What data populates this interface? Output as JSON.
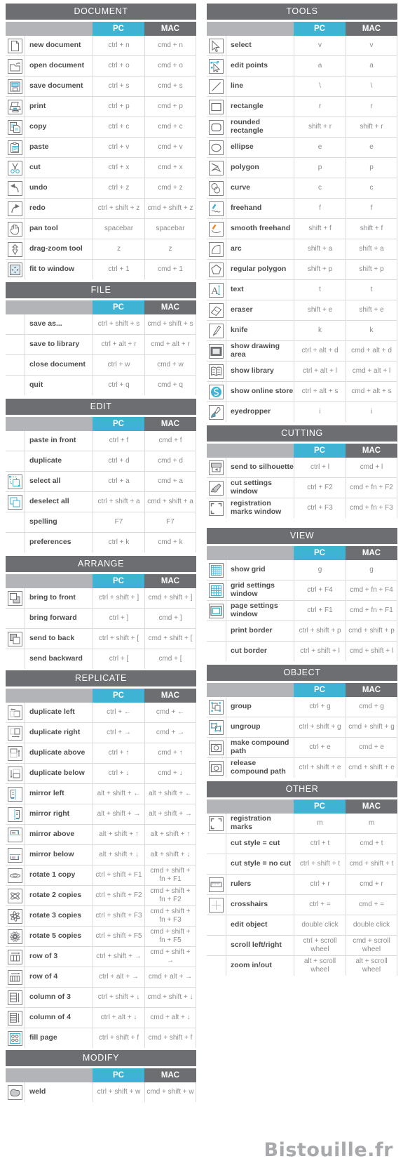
{
  "theme": {
    "section_header_bg": "#6d6e71",
    "pc_header_bg": "#3eb3d4",
    "mac_header_bg": "#6d6e71",
    "blank_header_bg": "#b3b4b8",
    "row_divider": "#d9dadb",
    "label_color": "#4d4d4f",
    "key_color": "#8a8b8e",
    "watermark_color": "#a7a9ac"
  },
  "columns": {
    "pc": "PC",
    "mac": "MAC"
  },
  "watermark": "Bistouille.fr",
  "left": [
    {
      "title": "DOCUMENT",
      "rows": [
        {
          "icon": "new-document-icon",
          "label": "new document",
          "pc": "ctrl + n",
          "mac": "cmd + n"
        },
        {
          "icon": "open-document-icon",
          "label": "open document",
          "pc": "ctrl + o",
          "mac": "cmd + o"
        },
        {
          "icon": "save-document-icon",
          "label": "save document",
          "pc": "ctrl + s",
          "mac": "cmd + s"
        },
        {
          "icon": "print-icon",
          "label": "print",
          "pc": "ctrl + p",
          "mac": "cmd + p"
        },
        {
          "icon": "copy-icon",
          "label": "copy",
          "pc": "ctrl + c",
          "mac": "cmd + c"
        },
        {
          "icon": "paste-icon",
          "label": "paste",
          "pc": "ctrl + v",
          "mac": "cmd + v"
        },
        {
          "icon": "cut-icon",
          "label": "cut",
          "pc": "ctrl + x",
          "mac": "cmd + x"
        },
        {
          "icon": "undo-icon",
          "label": "undo",
          "pc": "ctrl + z",
          "mac": "cmd + z"
        },
        {
          "icon": "redo-icon",
          "label": "redo",
          "pc": "ctrl + shift + z",
          "mac": "cmd + shift + z"
        },
        {
          "icon": "pan-tool-icon",
          "label": "pan tool",
          "pc": "spacebar",
          "mac": "spacebar"
        },
        {
          "icon": "drag-zoom-tool-icon",
          "label": "drag-zoom tool",
          "pc": "z",
          "mac": "z"
        },
        {
          "icon": "fit-to-window-icon",
          "label": "fit to window",
          "pc": "ctrl + 1",
          "mac": "cmd + 1"
        }
      ]
    },
    {
      "title": "FILE",
      "rows": [
        {
          "icon": null,
          "label": "save as...",
          "pc": "ctrl + shift + s",
          "mac": "cmd + shift + s"
        },
        {
          "icon": null,
          "label": "save to library",
          "pc": "ctrl + alt + r",
          "mac": "cmd + alt + r"
        },
        {
          "icon": null,
          "label": "close document",
          "pc": "ctrl + w",
          "mac": "cmd + w"
        },
        {
          "icon": null,
          "label": "quit",
          "pc": "ctrl + q",
          "mac": "cmd + q"
        }
      ]
    },
    {
      "title": "EDIT",
      "rows": [
        {
          "icon": null,
          "label": "paste in front",
          "pc": "ctrl + f",
          "mac": "cmd + f"
        },
        {
          "icon": null,
          "label": "duplicate",
          "pc": "ctrl + d",
          "mac": "cmd + d"
        },
        {
          "icon": "select-all-icon",
          "label": "select all",
          "pc": "ctrl + a",
          "mac": "cmd + a"
        },
        {
          "icon": "deselect-all-icon",
          "label": "deselect all",
          "pc": "ctrl + shift + a",
          "mac": "cmd + shift + a"
        },
        {
          "icon": null,
          "label": "spelling",
          "pc": "F7",
          "mac": "F7"
        },
        {
          "icon": null,
          "label": "preferences",
          "pc": "ctrl + k",
          "mac": "cmd + k"
        }
      ]
    },
    {
      "title": "ARRANGE",
      "rows": [
        {
          "icon": "bring-to-front-icon",
          "label": "bring to front",
          "pc": "ctrl + shift + ]",
          "mac": "cmd + shift + ]"
        },
        {
          "icon": null,
          "label": "bring forward",
          "pc": "ctrl + ]",
          "mac": "cmd + ]"
        },
        {
          "icon": "send-to-back-icon",
          "label": "send to back",
          "pc": "ctrl + shift  + [",
          "mac": "cmd + shift + ["
        },
        {
          "icon": null,
          "label": "send backward",
          "pc": "ctrl + [",
          "mac": "cmd + ["
        }
      ]
    },
    {
      "title": "REPLICATE",
      "rows": [
        {
          "icon": "duplicate-left-icon",
          "label": "duplicate left",
          "pc": "ctrl + ←",
          "mac": "cmd + ←"
        },
        {
          "icon": "duplicate-right-icon",
          "label": "duplicate right",
          "pc": "ctrl + →",
          "mac": "cmd + →"
        },
        {
          "icon": "duplicate-above-icon",
          "label": "duplicate above",
          "pc": "ctrl + ↑",
          "mac": "cmd + ↑"
        },
        {
          "icon": "duplicate-below-icon",
          "label": "duplicate below",
          "pc": "ctrl + ↓",
          "mac": "cmd + ↓"
        },
        {
          "icon": "mirror-left-icon",
          "label": "mirror left",
          "pc": "alt + shift + ←",
          "mac": "alt + shift + ←"
        },
        {
          "icon": "mirror-right-icon",
          "label": "mirror right",
          "pc": "alt + shift + →",
          "mac": "alt + shift + →"
        },
        {
          "icon": "mirror-above-icon",
          "label": "mirror above",
          "pc": "alt + shift + ↑",
          "mac": "alt + shift + ↑"
        },
        {
          "icon": "mirror-below-icon",
          "label": "mirror below",
          "pc": "alt + shift + ↓",
          "mac": "alt + shift + ↓"
        },
        {
          "icon": "rotate-1-copy-icon",
          "label": "rotate 1 copy",
          "pc": "ctrl + shift + F1",
          "mac": "cmd + shift + fn + F1"
        },
        {
          "icon": "rotate-2-copies-icon",
          "label": "rotate 2 copies",
          "pc": "ctrl + shift + F2",
          "mac": "cmd + shift + fn + F2"
        },
        {
          "icon": "rotate-3-copies-icon",
          "label": "rotate 3 copies",
          "pc": "ctrl + shift + F3",
          "mac": "cmd + shift + fn + F3"
        },
        {
          "icon": "rotate-5-copies-icon",
          "label": "rotate 5 copies",
          "pc": "ctrl + shift + F5",
          "mac": "cmd + shift + fn + F5"
        },
        {
          "icon": "row-of-3-icon",
          "label": "row of 3",
          "pc": "ctrl + shift + →",
          "mac": "cmd + shift + →"
        },
        {
          "icon": "row-of-4-icon",
          "label": "row of 4",
          "pc": "ctrl + alt + →",
          "mac": "cmd + alt + →"
        },
        {
          "icon": "column-of-3-icon",
          "label": "column of 3",
          "pc": "ctrl + shift + ↓",
          "mac": "cmd + shift + ↓"
        },
        {
          "icon": "column-of-4-icon",
          "label": "column of 4",
          "pc": "ctrl + alt + ↓",
          "mac": "cmd + alt + ↓"
        },
        {
          "icon": "fill-page-icon",
          "label": "fill page",
          "pc": "ctrl + shift + f",
          "mac": "cmd + shift + f"
        }
      ]
    },
    {
      "title": "MODIFY",
      "rows": [
        {
          "icon": "weld-icon",
          "label": "weld",
          "pc": "ctrl + shift + w",
          "mac": "cmd + shift + w"
        }
      ]
    }
  ],
  "right": [
    {
      "title": "TOOLS",
      "rows": [
        {
          "icon": "select-icon",
          "label": "select",
          "pc": "v",
          "mac": "v"
        },
        {
          "icon": "edit-points-icon",
          "label": "edit points",
          "pc": "a",
          "mac": "a"
        },
        {
          "icon": "line-icon",
          "label": "line",
          "pc": "\\",
          "mac": "\\"
        },
        {
          "icon": "rectangle-icon",
          "label": "rectangle",
          "pc": "r",
          "mac": "r"
        },
        {
          "icon": "rounded-rectangle-icon",
          "label": "rounded rectangle",
          "pc": "shift + r",
          "mac": "shift + r"
        },
        {
          "icon": "ellipse-icon",
          "label": "ellipse",
          "pc": "e",
          "mac": "e"
        },
        {
          "icon": "polygon-icon",
          "label": "polygon",
          "pc": "p",
          "mac": "p"
        },
        {
          "icon": "curve-icon",
          "label": "curve",
          "pc": "c",
          "mac": "c"
        },
        {
          "icon": "freehand-icon",
          "label": "freehand",
          "pc": "f",
          "mac": "f"
        },
        {
          "icon": "smooth-freehand-icon",
          "label": "smooth freehand",
          "pc": "shift + f",
          "mac": "shift + f"
        },
        {
          "icon": "arc-icon",
          "label": "arc",
          "pc": "shift + a",
          "mac": "shift + a"
        },
        {
          "icon": "regular-polygon-icon",
          "label": "regular polygon",
          "pc": "shift + p",
          "mac": "shift + p"
        },
        {
          "icon": "text-icon",
          "label": "text",
          "pc": "t",
          "mac": "t"
        },
        {
          "icon": "eraser-icon",
          "label": "eraser",
          "pc": "shift + e",
          "mac": "shift + e"
        },
        {
          "icon": "knife-icon",
          "label": "knife",
          "pc": "k",
          "mac": "k"
        },
        {
          "icon": "show-drawing-area-icon",
          "label": "show drawing area",
          "pc": "ctrl + alt + d",
          "mac": "cmd + alt + d"
        },
        {
          "icon": "show-library-icon",
          "label": "show library",
          "pc": "ctrl + alt + l",
          "mac": "cmd + alt + l"
        },
        {
          "icon": "show-online-store-icon",
          "label": "show online store",
          "pc": "ctrl + alt + s",
          "mac": "cmd + alt + s"
        },
        {
          "icon": "eyedropper-icon",
          "label": "eyedropper",
          "pc": "i",
          "mac": "i"
        }
      ]
    },
    {
      "title": "CUTTING",
      "rows": [
        {
          "icon": "send-to-silhouette-icon",
          "label": "send to silhouette",
          "pc": "ctrl + l",
          "mac": "cmd + l"
        },
        {
          "icon": "cut-settings-window-icon",
          "label": "cut settings window",
          "pc": "ctrl + F2",
          "mac": "cmd + fn + F2"
        },
        {
          "icon": "registration-marks-window-icon",
          "label": "registration marks window",
          "pc": "ctrl + F3",
          "mac": "cmd + fn + F3"
        }
      ]
    },
    {
      "title": "VIEW",
      "rows": [
        {
          "icon": "show-grid-icon",
          "label": "show grid",
          "pc": "g",
          "mac": "g"
        },
        {
          "icon": "grid-settings-window-icon",
          "label": "grid settings window",
          "pc": "ctrl + F4",
          "mac": "cmd + fn + F4"
        },
        {
          "icon": "page-settings-window-icon",
          "label": "page settings window",
          "pc": "ctrl + F1",
          "mac": "cmd + fn + F1"
        },
        {
          "icon": null,
          "label": "print border",
          "pc": "ctrl + shift + p",
          "mac": "cmd + shift + p"
        },
        {
          "icon": null,
          "label": "cut border",
          "pc": "ctrl + shift + l",
          "mac": "cmd + shift + l"
        }
      ]
    },
    {
      "title": "OBJECT",
      "rows": [
        {
          "icon": "group-icon",
          "label": "group",
          "pc": "ctrl + g",
          "mac": "cmd + g"
        },
        {
          "icon": "ungroup-icon",
          "label": "ungroup",
          "pc": "ctrl + shift + g",
          "mac": "cmd + shift + g"
        },
        {
          "icon": "make-compound-path-icon",
          "label": "make compound path",
          "pc": "ctrl + e",
          "mac": "cmd + e"
        },
        {
          "icon": "release-compound-path-icon",
          "label": "release compound path",
          "pc": "ctrl + shift + e",
          "mac": "cmd + shift + e"
        }
      ]
    },
    {
      "title": "OTHER",
      "rows": [
        {
          "icon": "registration-marks-icon",
          "label": "registration marks",
          "pc": "m",
          "mac": "m"
        },
        {
          "icon": null,
          "label": "cut style = cut",
          "pc": "ctrl + t",
          "mac": "cmd + t"
        },
        {
          "icon": null,
          "label": "cut style = no cut",
          "pc": "ctrl + shift + t",
          "mac": "cmd + shift + t"
        },
        {
          "icon": "rulers-icon",
          "label": "rulers",
          "pc": "ctrl + r",
          "mac": "cmd + r"
        },
        {
          "icon": "crosshairs-icon",
          "label": "crosshairs",
          "pc": "ctrl + =",
          "mac": "cmd + ="
        },
        {
          "icon": null,
          "label": "edit object",
          "pc": "double click",
          "mac": "double click"
        },
        {
          "icon": null,
          "label": "scroll left/right",
          "pc": "ctrl + scroll wheel",
          "mac": "cmd + scroll wheel"
        },
        {
          "icon": null,
          "label": "zoom in/out",
          "pc": "alt + scroll wheel",
          "mac": "alt + scroll wheel"
        }
      ]
    }
  ]
}
